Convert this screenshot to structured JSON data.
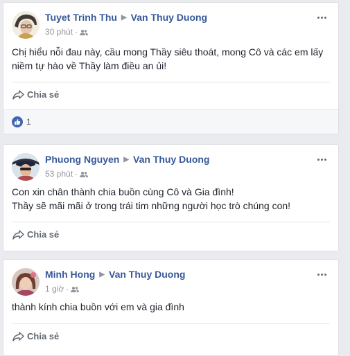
{
  "posts": [
    {
      "author": "Tuyet Trinh Thu",
      "target": "Van Thuy Duong",
      "time": "30 phút",
      "text": "Chị hiểu nỗi đau này, cầu mong Thầy siêu thoát, mong Cô và các em lấy niềm tự hào về Thầy làm điều an ủi!",
      "share_label": "Chia sẻ",
      "like_count": "1"
    },
    {
      "author": "Phuong Nguyen",
      "target": "Van Thuy Duong",
      "time": "53 phút",
      "text_lines": [
        "Con xin chân thành chia buồn cùng Cô và Gia đình!",
        "Thầy sẽ mãi mãi ở trong trái tim những người học trò chúng con!"
      ],
      "share_label": "Chia sẻ"
    },
    {
      "author": "Minh Hong",
      "target": "Van Thuy Duong",
      "time": "1 giờ",
      "text": "thành kính chia buồn với em và gia đình",
      "share_label": "Chia sẻ"
    }
  ],
  "icons": {
    "audience": "friends-icon",
    "share": "share-arrow-icon",
    "more": "more-options-icon",
    "like": "like-thumb-icon"
  },
  "colors": {
    "link": "#365899",
    "meta": "#90949c",
    "like_badge": "#4267b2",
    "background": "#e9ebee"
  }
}
